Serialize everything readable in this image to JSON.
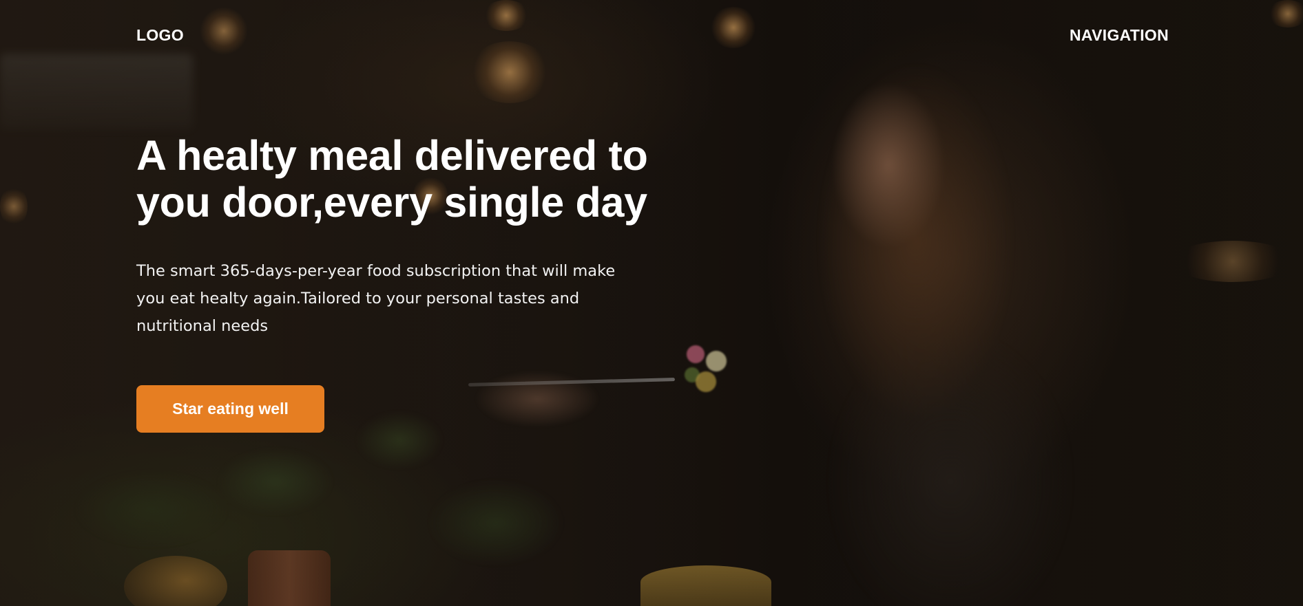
{
  "header": {
    "logo": "LOGO",
    "navigation": "NAVIGATION"
  },
  "hero": {
    "headline": "A healty meal delivered to you door,every single day",
    "description": "The smart 365-days-per-year food subscription that will make you eat healty again.Tailored to your personal tastes and nutritional needs",
    "cta_label": "Star eating well"
  },
  "colors": {
    "accent": "#e67e22",
    "text": "#ffffff"
  }
}
